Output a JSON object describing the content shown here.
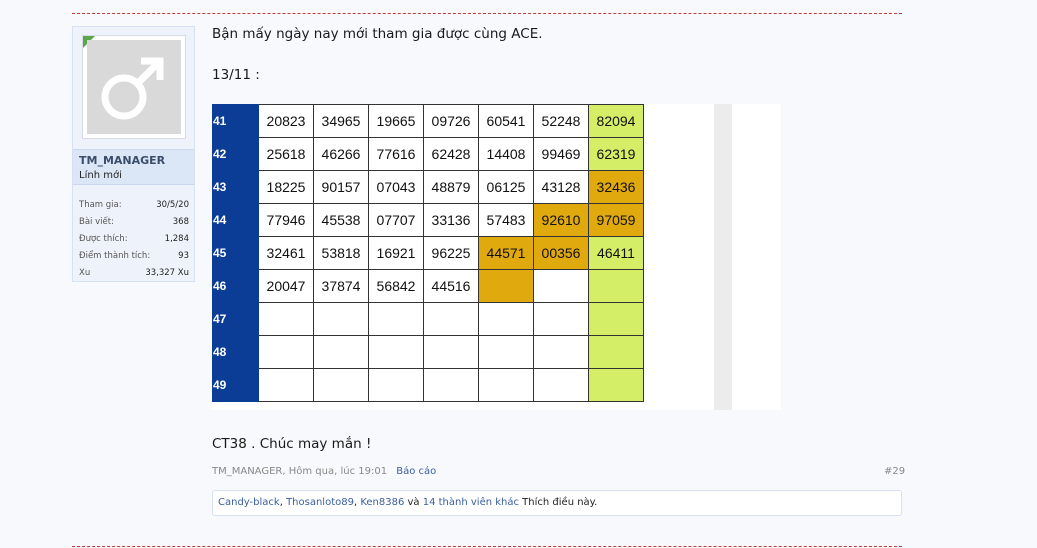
{
  "user": {
    "name": "TM_MANAGER",
    "title": "Lính mới",
    "avatar_icon": "male-symbol-icon",
    "stats": [
      {
        "label": "Tham gia:",
        "value": "30/5/20"
      },
      {
        "label": "Bài viết:",
        "value": "368"
      },
      {
        "label": "Được thích:",
        "value": "1,284"
      },
      {
        "label": "Điểm thành tích:",
        "value": "93"
      },
      {
        "label": "Xu",
        "value": "33,327 Xu"
      }
    ]
  },
  "post": {
    "line1": "Bận mấy ngày nay mới tham gia được cùng ACE.",
    "date": "13/11 :",
    "closing": "CT38 . Chúc may mắn !",
    "author_time": "TM_MANAGER, Hôm qua, lúc 19:01",
    "report": "Báo cáo",
    "number": "#29"
  },
  "likes": {
    "users": [
      "Candy-black",
      "Thosanloto89",
      "Ken8386"
    ],
    "sep1": ", ",
    "sep2": ", ",
    "and": " và ",
    "others": "14 thành viên khác",
    "suffix": " Thích điều này."
  },
  "table": {
    "colors": {
      "header": "#0b3d96",
      "highlight": "#e0a90e",
      "green": "#d4ee68"
    },
    "rows": [
      {
        "label": "41",
        "cells": [
          "20823",
          "34965",
          "19665",
          "09726",
          "60541",
          "52248",
          "82094"
        ],
        "hl": [],
        "gr": [
          6
        ]
      },
      {
        "label": "42",
        "cells": [
          "25618",
          "46266",
          "77616",
          "62428",
          "14408",
          "99469",
          "62319"
        ],
        "hl": [],
        "gr": [
          6
        ]
      },
      {
        "label": "43",
        "cells": [
          "18225",
          "90157",
          "07043",
          "48879",
          "06125",
          "43128",
          "32436"
        ],
        "hl": [
          6
        ],
        "gr": []
      },
      {
        "label": "44",
        "cells": [
          "77946",
          "45538",
          "07707",
          "33136",
          "57483",
          "92610",
          "97059"
        ],
        "hl": [
          5,
          6
        ],
        "gr": []
      },
      {
        "label": "45",
        "cells": [
          "32461",
          "53818",
          "16921",
          "96225",
          "44571",
          "00356",
          "46411"
        ],
        "hl": [
          4,
          5
        ],
        "gr": [
          6
        ]
      },
      {
        "label": "46",
        "cells": [
          "20047",
          "37874",
          "56842",
          "44516",
          "",
          "",
          ""
        ],
        "hl": [
          4
        ],
        "gr": [
          6
        ]
      },
      {
        "label": "47",
        "cells": [
          "",
          "",
          "",
          "",
          "",
          "",
          ""
        ],
        "hl": [],
        "gr": [
          6
        ]
      },
      {
        "label": "48",
        "cells": [
          "",
          "",
          "",
          "",
          "",
          "",
          ""
        ],
        "hl": [],
        "gr": [
          6
        ]
      },
      {
        "label": "49",
        "cells": [
          "",
          "",
          "",
          "",
          "",
          "",
          ""
        ],
        "hl": [],
        "gr": [
          6
        ]
      }
    ]
  }
}
